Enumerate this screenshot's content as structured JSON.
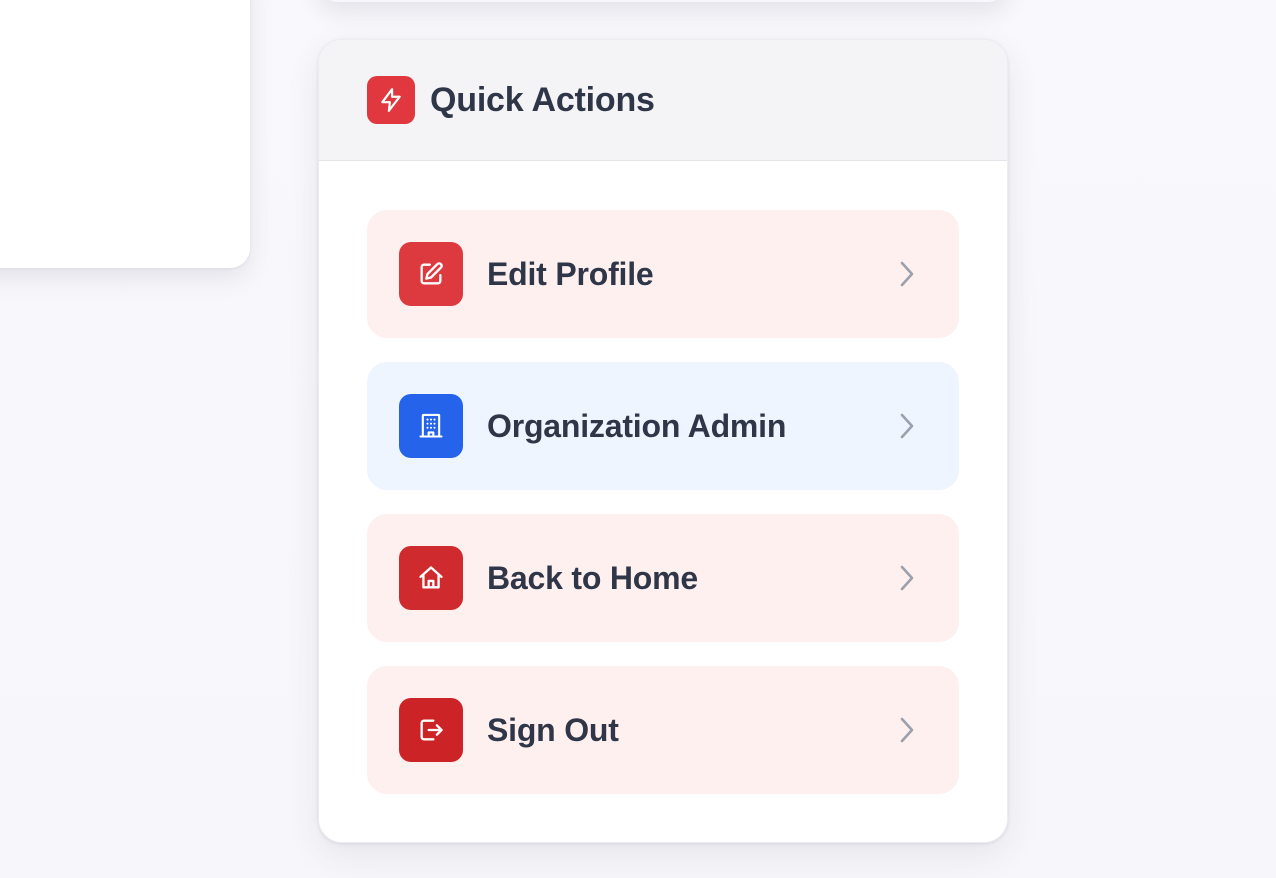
{
  "colors": {
    "accent_red": "#e0383e",
    "edit_icon_bg": "#dc3a3f",
    "org_icon_bg": "#2563eb",
    "home_icon_bg": "#cf2a2e",
    "signout_icon_bg": "#cc2327",
    "pink_row_bg": "#fff0f0",
    "blue_row_bg": "#eef5fe",
    "text_dark": "#2f3648",
    "chevron": "#9aa0ae"
  },
  "quick_actions": {
    "title": "Quick Actions",
    "header_icon": "lightning-bolt-icon",
    "items": [
      {
        "label": "Edit Profile",
        "icon": "edit-icon",
        "tone": "pink"
      },
      {
        "label": "Organization Admin",
        "icon": "building-icon",
        "tone": "blue"
      },
      {
        "label": "Back to Home",
        "icon": "home-icon",
        "tone": "pink"
      },
      {
        "label": "Sign Out",
        "icon": "sign-out-icon",
        "tone": "pink"
      }
    ]
  }
}
